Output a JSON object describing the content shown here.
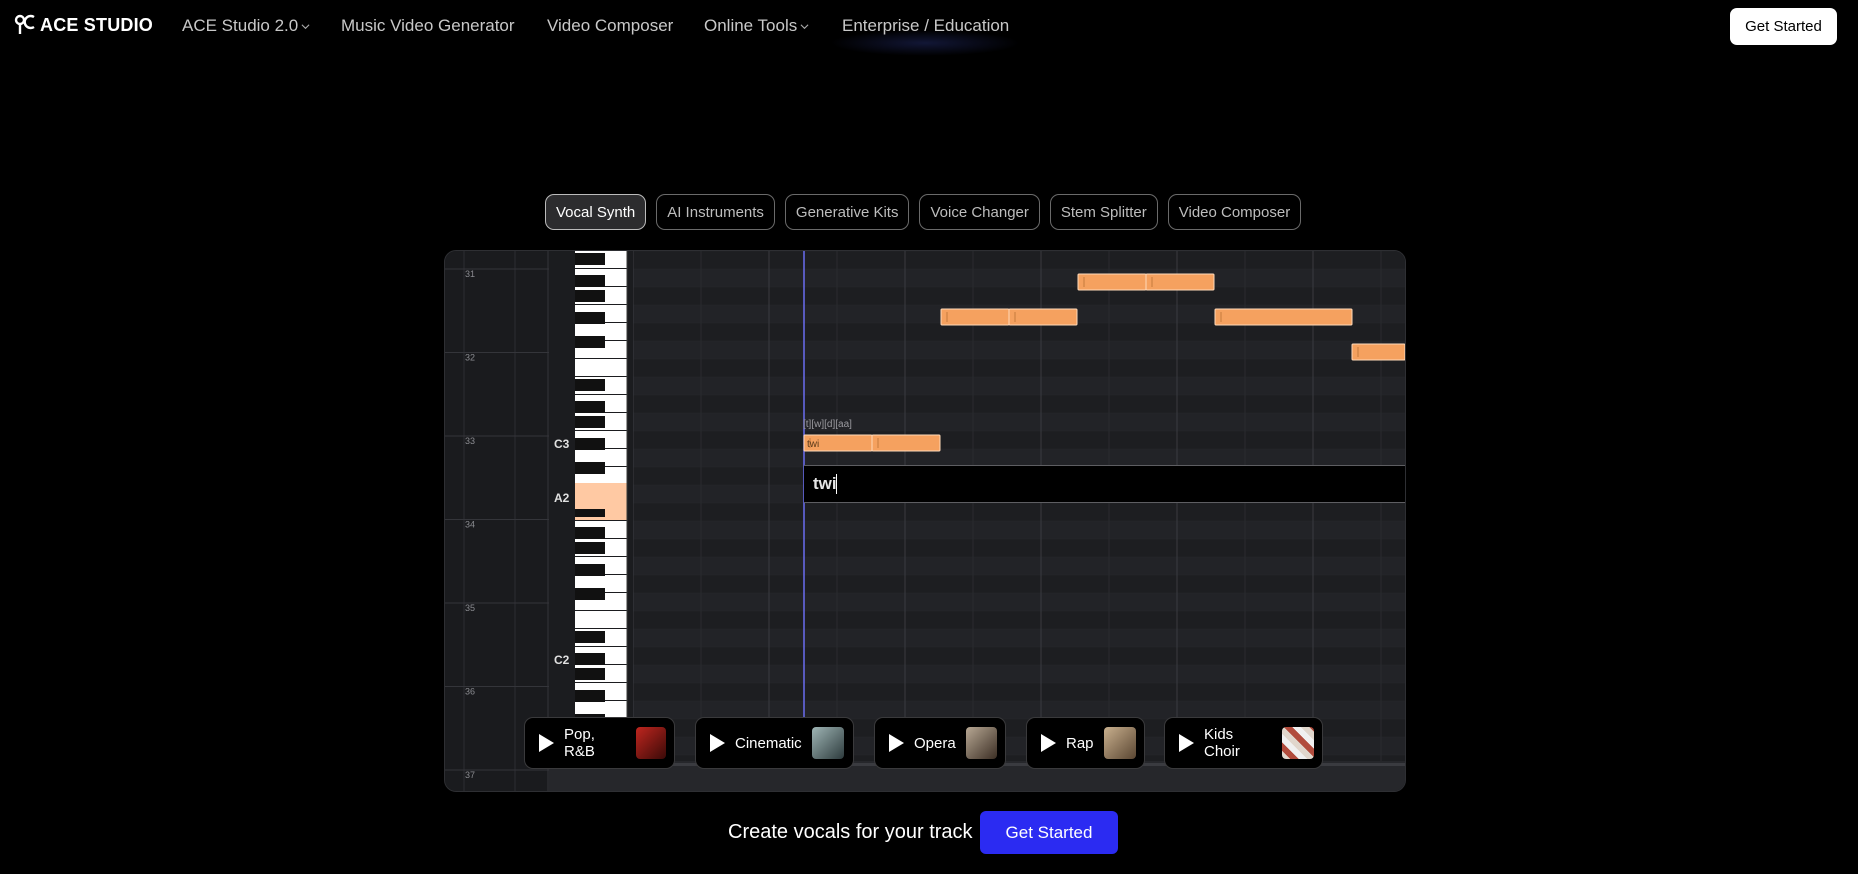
{
  "nav": {
    "logo_text": "ACE STUDIO",
    "items": [
      {
        "label": "ACE Studio 2.0",
        "dropdown": true
      },
      {
        "label": "Music Video Generator",
        "dropdown": false
      },
      {
        "label": "Video Composer",
        "dropdown": false
      },
      {
        "label": "Online Tools",
        "dropdown": true
      },
      {
        "label": "Enterprise / Education",
        "dropdown": false
      }
    ],
    "cta": "Get Started"
  },
  "tabs": [
    {
      "label": "Vocal Synth",
      "active": true
    },
    {
      "label": "AI Instruments",
      "active": false
    },
    {
      "label": "Generative Kits",
      "active": false
    },
    {
      "label": "Voice Changer",
      "active": false
    },
    {
      "label": "Stem Splitter",
      "active": false
    },
    {
      "label": "Video Composer",
      "active": false
    }
  ],
  "editor": {
    "bar_numbers": [
      "31",
      "32",
      "33",
      "34",
      "35",
      "36",
      "37"
    ],
    "octave_labels": [
      "C3",
      "A2",
      "C2"
    ],
    "phoneme_label": "[t][w][d][aa]",
    "note_lyric": "twi",
    "lyric_input_value": "twi"
  },
  "voices": [
    {
      "label": "Pop, R&B"
    },
    {
      "label": "Cinematic"
    },
    {
      "label": "Opera"
    },
    {
      "label": "Rap"
    },
    {
      "label": "Kids Choir"
    }
  ],
  "cta": {
    "text": "Create vocals for your track",
    "button": "Get Started"
  },
  "colors": {
    "note_fill": "#f5a15f",
    "accent_blue": "#2b2bf2"
  }
}
